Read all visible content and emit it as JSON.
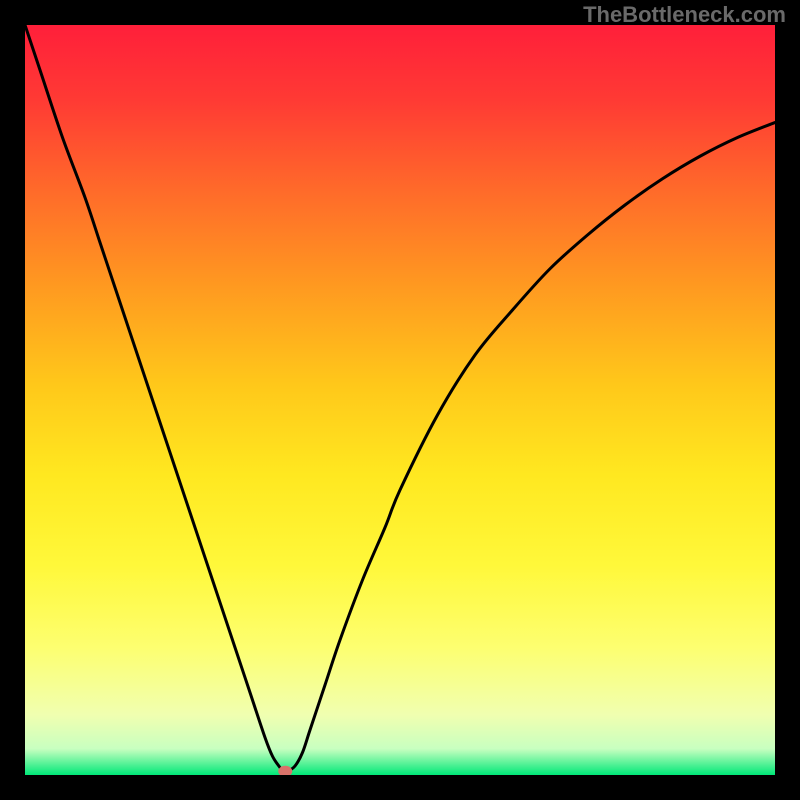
{
  "watermark": "TheBottleneck.com",
  "chart_data": {
    "type": "line",
    "title": "",
    "xlabel": "",
    "ylabel": "",
    "xlim": [
      0,
      100
    ],
    "ylim": [
      0,
      100
    ],
    "x": [
      0,
      2,
      5,
      8,
      10,
      12,
      15,
      18,
      20,
      22,
      25,
      28,
      30,
      32,
      33,
      34,
      34.5,
      35,
      36,
      37,
      38,
      40,
      42,
      45,
      48,
      50,
      55,
      60,
      65,
      70,
      75,
      80,
      85,
      90,
      95,
      100
    ],
    "y": [
      100,
      94,
      85,
      77,
      71,
      65,
      56,
      47,
      41,
      35,
      26,
      17,
      11,
      5,
      2.5,
      1,
      0.5,
      0.5,
      1.2,
      3,
      6,
      12,
      18,
      26,
      33,
      38,
      48,
      56,
      62,
      67.5,
      72,
      76,
      79.5,
      82.5,
      85,
      87
    ],
    "marker": {
      "x": 34.7,
      "y": 0.5
    },
    "gradient_stops": [
      {
        "offset": 0.0,
        "color": "#ff1f3a"
      },
      {
        "offset": 0.1,
        "color": "#ff3a34"
      },
      {
        "offset": 0.22,
        "color": "#ff6a2a"
      },
      {
        "offset": 0.35,
        "color": "#ff9a20"
      },
      {
        "offset": 0.48,
        "color": "#ffc81a"
      },
      {
        "offset": 0.6,
        "color": "#ffe820"
      },
      {
        "offset": 0.72,
        "color": "#fff83a"
      },
      {
        "offset": 0.83,
        "color": "#fdff70"
      },
      {
        "offset": 0.92,
        "color": "#f0ffb0"
      },
      {
        "offset": 0.965,
        "color": "#c8ffc0"
      },
      {
        "offset": 1.0,
        "color": "#00e878"
      }
    ]
  }
}
